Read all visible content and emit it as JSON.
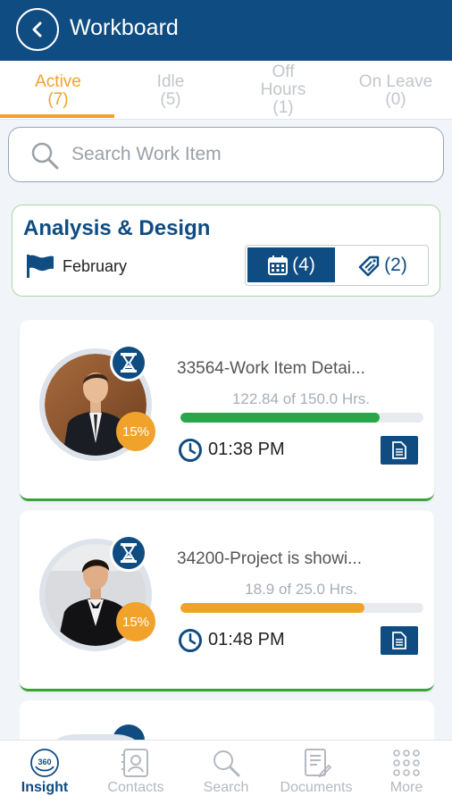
{
  "header": {
    "title": "Workboard"
  },
  "tabs": [
    {
      "name": "Active",
      "count": "(7)"
    },
    {
      "name": "Idle",
      "count": "(5)"
    },
    {
      "name": "Off",
      "name2": "Hours",
      "count": "(1)"
    },
    {
      "name": "On Leave",
      "count": "(0)"
    }
  ],
  "search": {
    "placeholder": "Search Work Item"
  },
  "project": {
    "title": "Analysis & Design",
    "month": "February",
    "calendar_count": "(4)",
    "tag_count": "(2)"
  },
  "work_items": [
    {
      "title": "33564-Work Item Detai...",
      "hours": "122.84 of 150.0 Hrs.",
      "progress": 0.8189,
      "bar_color": "#2aa64a",
      "time": "01:38 PM",
      "percent": "15%"
    },
    {
      "title": "34200-Project is showi...",
      "hours": "18.9 of 25.0 Hrs.",
      "progress": 0.756,
      "bar_color": "#f0a22b",
      "time": "01:48 PM",
      "percent": "15%"
    }
  ],
  "nav": [
    {
      "label": "Insight",
      "icon": "insight-360-icon"
    },
    {
      "label": "Contacts",
      "icon": "contacts-icon"
    },
    {
      "label": "Search",
      "icon": "search-icon"
    },
    {
      "label": "Documents",
      "icon": "documents-icon"
    },
    {
      "label": "More",
      "icon": "more-grid-icon"
    }
  ],
  "colors": {
    "primary": "#0f4c81",
    "accent": "#f0a22b",
    "success": "#2aa64a"
  }
}
